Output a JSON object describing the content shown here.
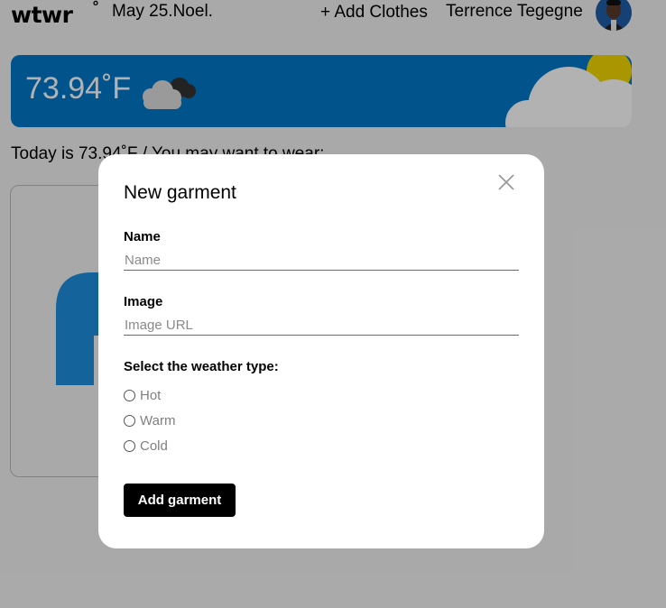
{
  "header": {
    "logo": "wtwr",
    "logo_mark": "°",
    "date_location": "May 25.Noel.",
    "add_clothes_label": "+ Add Clothes",
    "username": "Terrence Tegegne"
  },
  "weather": {
    "temperature": "73.94˚F",
    "condition_icon": "cloudy-icon",
    "card_color": "#0078c8"
  },
  "main": {
    "today_text": "Today is 73.94˚F / You may want to wear:"
  },
  "modal": {
    "title": "New garment",
    "name_label": "Name",
    "name_placeholder": "Name",
    "name_value": "",
    "image_label": "Image",
    "image_placeholder": "Image URL",
    "image_value": "",
    "weather_type_label": "Select the weather type:",
    "weather_options": [
      "Hot",
      "Warm",
      "Cold"
    ],
    "selected_option": null,
    "submit_label": "Add garment",
    "close_icon": "close-icon"
  }
}
